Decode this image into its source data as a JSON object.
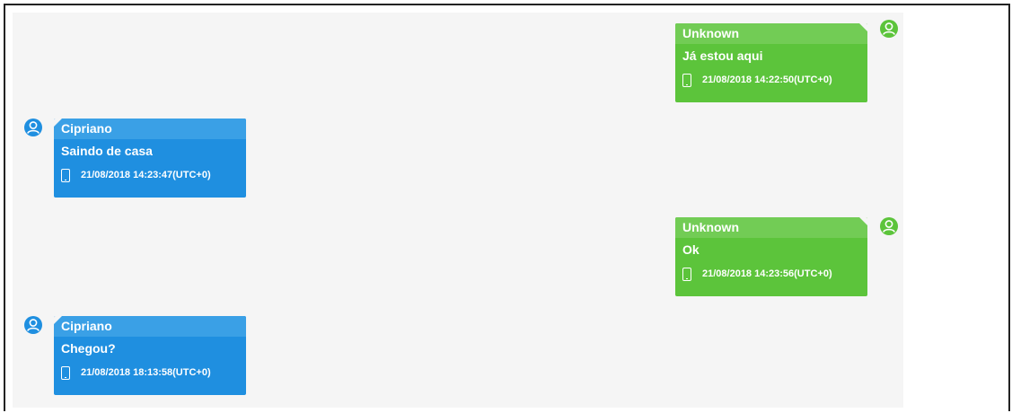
{
  "messages": [
    {
      "sender": "Unknown",
      "text": "Já estou aqui",
      "timestamp": "21/08/2018 14:22:50(UTC+0)",
      "direction": "outgoing"
    },
    {
      "sender": "Cipriano",
      "text": "Saindo de casa",
      "timestamp": "21/08/2018 14:23:47(UTC+0)",
      "direction": "incoming"
    },
    {
      "sender": "Unknown",
      "text": "Ok",
      "timestamp": "21/08/2018 14:23:56(UTC+0)",
      "direction": "outgoing"
    },
    {
      "sender": "Cipriano",
      "text": "Chegou?",
      "timestamp": "21/08/2018 18:13:58(UTC+0)",
      "direction": "incoming"
    }
  ],
  "colors": {
    "outgoing": "#5cc43b",
    "incoming": "#1f8fe0",
    "background": "#f5f5f5"
  },
  "icons": {
    "avatar": "user-avatar-icon",
    "device": "phone-icon"
  }
}
